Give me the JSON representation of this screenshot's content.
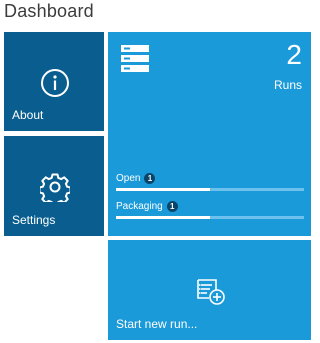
{
  "page": {
    "title": "Dashboard"
  },
  "tiles": {
    "about": {
      "label": "About",
      "icon": "info-icon"
    },
    "settings": {
      "label": "Settings",
      "icon": "gear-icon"
    },
    "runs": {
      "count": "2",
      "label": "Runs",
      "icon": "server-icon",
      "statuses": [
        {
          "label": "Open",
          "count": "1",
          "progress": 0.5
        },
        {
          "label": "Packaging",
          "count": "1",
          "progress": 0.5
        }
      ]
    },
    "new_run": {
      "label": "Start new run...",
      "icon": "new-run-icon"
    }
  },
  "colors": {
    "dark_tile": "#0a5e8f",
    "light_tile": "#1b9ad9",
    "badge": "#0a4468"
  }
}
